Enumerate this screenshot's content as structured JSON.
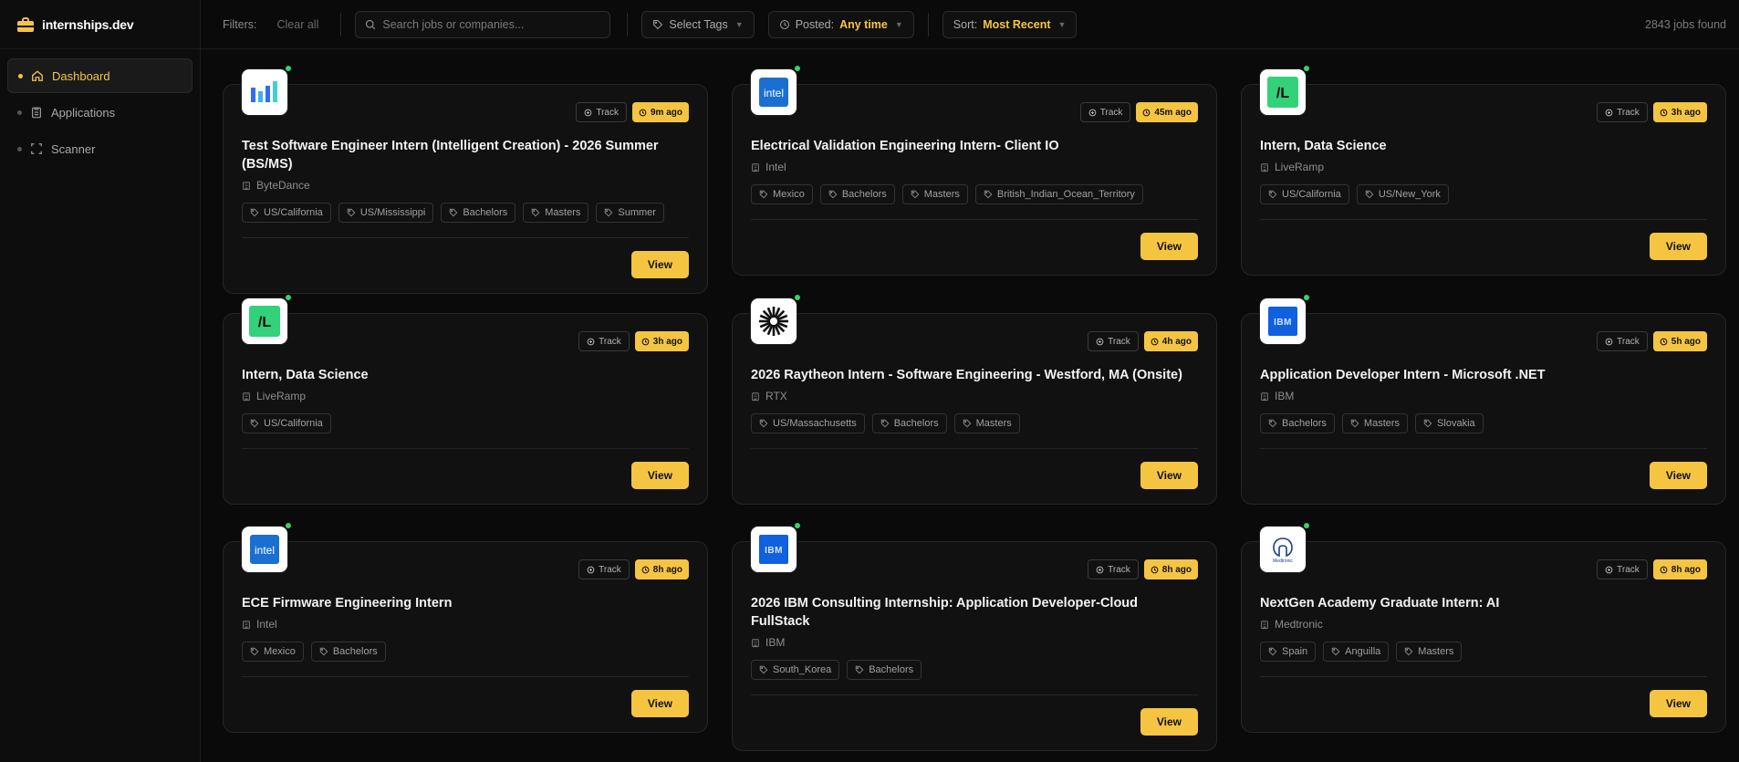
{
  "brand": {
    "name": "internships.dev"
  },
  "sidebar": {
    "items": [
      {
        "label": "Dashboard",
        "icon": "home-icon",
        "active": true
      },
      {
        "label": "Applications",
        "icon": "clipboard-icon",
        "active": false
      },
      {
        "label": "Scanner",
        "icon": "scan-icon",
        "active": false
      }
    ]
  },
  "filters": {
    "label": "Filters:",
    "clear_all": "Clear all",
    "search_placeholder": "Search jobs or companies...",
    "tags_label": "Select Tags",
    "posted_label": "Posted:",
    "posted_value": "Any time",
    "sort_label": "Sort:",
    "sort_value": "Most Recent",
    "jobs_found": "2843 jobs found"
  },
  "colors": {
    "accent": "#f5c542",
    "online": "#36d36b",
    "background": "#0a0a0a",
    "card": "#111111"
  },
  "card_labels": {
    "track": "Track",
    "view": "View"
  },
  "jobs": [
    {
      "title": "Test Software Engineer Intern (Intelligent Creation) - 2026 Summer (BS/MS)",
      "company": "ByteDance",
      "ago": "9m ago",
      "logo": "bytedance-logo",
      "tags": [
        "US/California",
        "US/Mississippi",
        "Bachelors",
        "Masters",
        "Summer"
      ]
    },
    {
      "title": "Electrical Validation Engineering Intern- Client IO",
      "company": "Intel",
      "ago": "45m ago",
      "logo": "intel-logo",
      "logo_text": "intel",
      "tags": [
        "Mexico",
        "Bachelors",
        "Masters",
        "British_Indian_Ocean_Territory"
      ]
    },
    {
      "title": "Intern, Data Science",
      "company": "LiveRamp",
      "ago": "3h ago",
      "logo": "liveramp-logo",
      "logo_text": "/L",
      "tags": [
        "US/California",
        "US/New_York"
      ]
    },
    {
      "title": "Intern, Data Science",
      "company": "LiveRamp",
      "ago": "3h ago",
      "logo": "liveramp-logo",
      "logo_text": "/L",
      "tags": [
        "US/California"
      ]
    },
    {
      "title": "2026 Raytheon Intern - Software Engineering - Westford, MA (Onsite)",
      "company": "RTX",
      "ago": "4h ago",
      "logo": "rtx-logo",
      "tags": [
        "US/Massachusetts",
        "Bachelors",
        "Masters"
      ]
    },
    {
      "title": "Application Developer Intern - Microsoft .NET",
      "company": "IBM",
      "ago": "5h ago",
      "logo": "ibm-logo",
      "logo_text": "IBM",
      "tags": [
        "Bachelors",
        "Masters",
        "Slovakia"
      ]
    },
    {
      "title": "ECE Firmware Engineering Intern",
      "company": "Intel",
      "ago": "8h ago",
      "logo": "intel-logo",
      "logo_text": "intel",
      "tags": [
        "Mexico",
        "Bachelors"
      ]
    },
    {
      "title": "2026 IBM Consulting Internship: Application Developer-Cloud FullStack",
      "company": "IBM",
      "ago": "8h ago",
      "logo": "ibm-logo",
      "logo_text": "IBM",
      "tags": [
        "South_Korea",
        "Bachelors"
      ]
    },
    {
      "title": "NextGen Academy Graduate Intern: AI",
      "company": "Medtronic",
      "ago": "8h ago",
      "logo": "medtronic-logo",
      "logo_text": "Medtronic",
      "tags": [
        "Spain",
        "Anguilla",
        "Masters"
      ]
    }
  ]
}
